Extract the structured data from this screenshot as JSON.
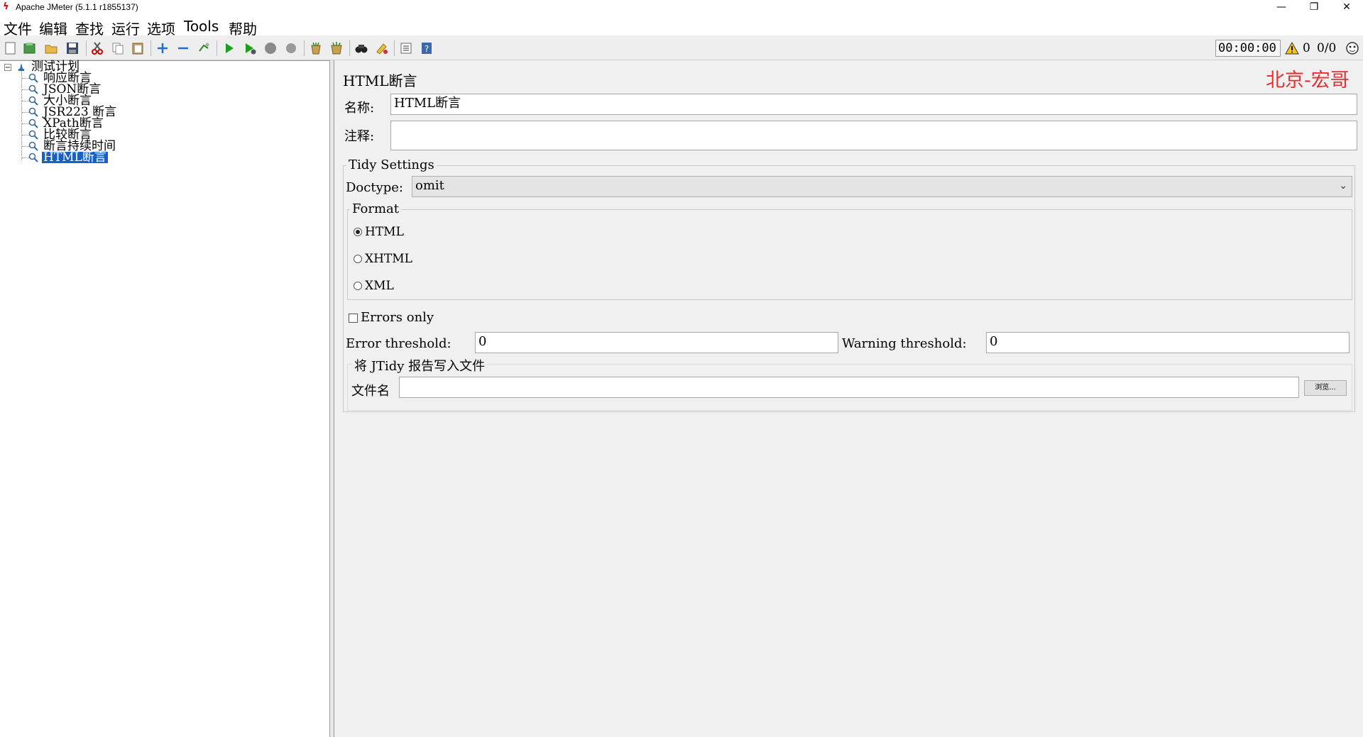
{
  "window": {
    "title": "Apache JMeter (5.1.1 r1855137)",
    "minimize": "—",
    "restore": "❐",
    "close": "✕"
  },
  "menu": [
    "文件",
    "编辑",
    "查找",
    "运行",
    "选项",
    "Tools",
    "帮助"
  ],
  "toolbar": {
    "timer": "00:00:00",
    "warning_count": "0",
    "threads": "0/0"
  },
  "tree": {
    "root": "测试计划",
    "items": [
      "响应断言",
      "JSON断言",
      "大小断言",
      "JSR223 断言",
      "XPath断言",
      "比较断言",
      "断言持续时间",
      "HTML断言"
    ],
    "selected_index": 7
  },
  "panel": {
    "title": "HTML断言",
    "watermark": "北京-宏哥",
    "name_label": "名称:",
    "name_value": "HTML断言",
    "comment_label": "注释:",
    "comment_value": "",
    "tidy_settings_title": "Tidy Settings",
    "doctype_label": "Doctype:",
    "doctype_value": "omit",
    "format_title": "Format",
    "format_options": [
      "HTML",
      "XHTML",
      "XML"
    ],
    "format_selected": "HTML",
    "errors_only_label": "Errors only",
    "errors_only_checked": false,
    "error_threshold_label": "Error threshold:",
    "error_threshold_value": "0",
    "warning_threshold_label": "Warning threshold:",
    "warning_threshold_value": "0",
    "write_file_title": "将 JTidy 报告写入文件",
    "filename_label": "文件名",
    "filename_value": "",
    "browse_label": "浏览..."
  },
  "colors": {
    "selection": "#1660c6",
    "watermark": "#e53030",
    "panel_bg": "#f0f0f0"
  }
}
